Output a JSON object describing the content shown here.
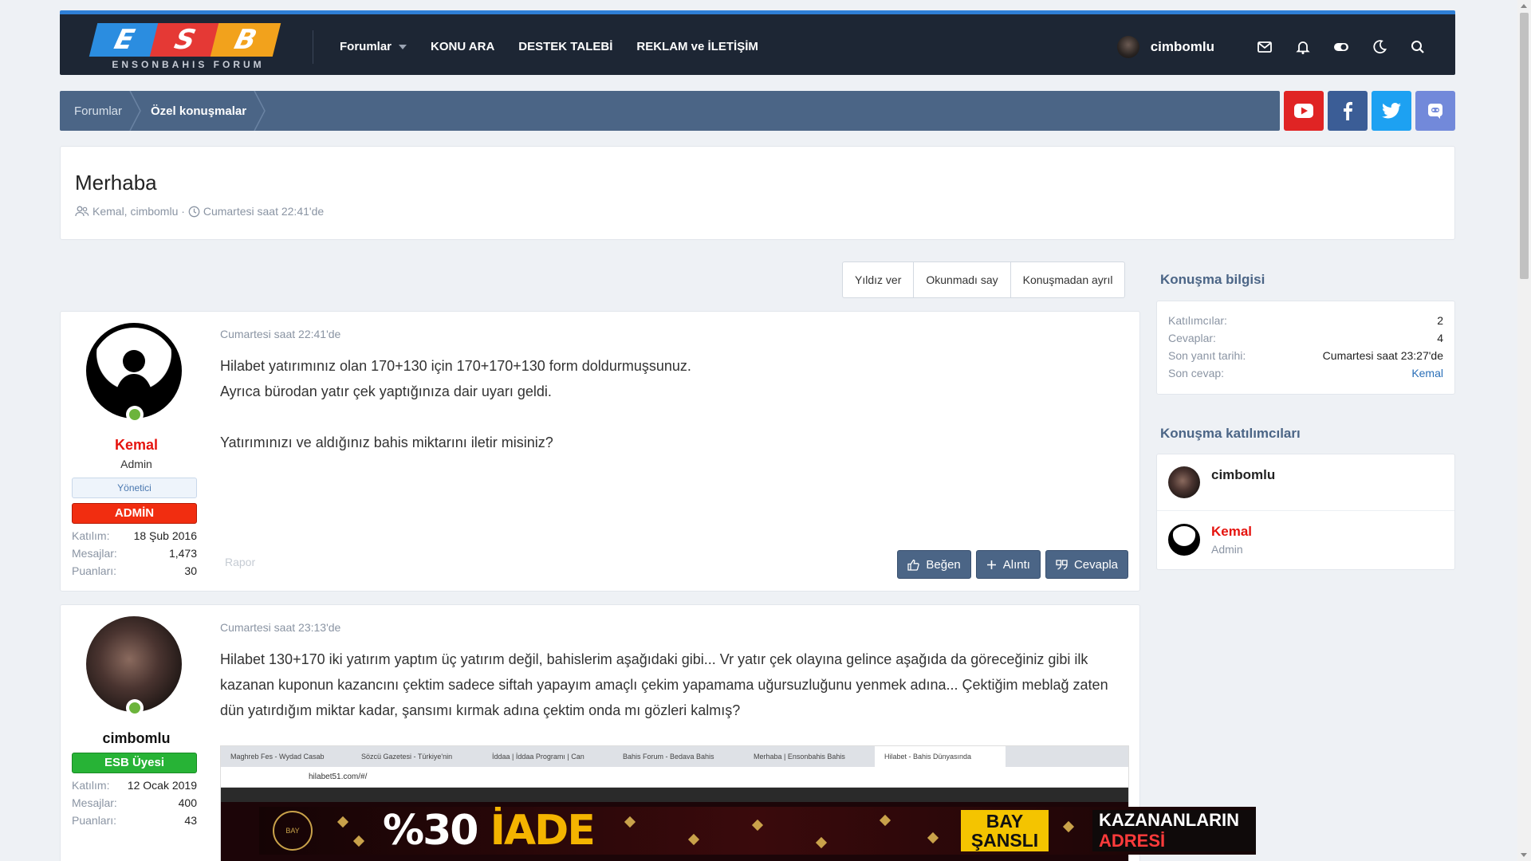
{
  "logo": {
    "letters": [
      "E",
      "S",
      "B"
    ],
    "subtitle": "ENSONBAHIS FORUM"
  },
  "nav": {
    "items": [
      "Forumlar",
      "KONU ARA",
      "DESTEK TALEBİ",
      "REKLAM ve İLETİŞİM"
    ]
  },
  "header": {
    "username": "cimbomlu",
    "icons": [
      "mail-icon",
      "bell-icon",
      "toggle-icon",
      "moon-icon",
      "search-icon"
    ]
  },
  "breadcrumb": {
    "items": [
      "Forumlar",
      "Özel konuşmalar"
    ]
  },
  "social": [
    "youtube-icon",
    "facebook-icon",
    "twitter-icon",
    "discord-icon"
  ],
  "colors": {
    "header_bg": "#1d2634",
    "accent": "#4b6586",
    "admin_red": "#f12d10",
    "esb_green": "#27b336",
    "username_red": "#e5140f"
  },
  "conversation": {
    "title": "Merhaba",
    "participants": "Kemal, cimbomlu",
    "date": "Cumartesi saat 22:41'de"
  },
  "buttons": {
    "star": "Yıldız ver",
    "unread": "Okunmadı say",
    "leave": "Konuşmadan ayrıl"
  },
  "messages": [
    {
      "username": "Kemal",
      "user_title": "Admin",
      "badge_group": "Yönetici",
      "badge_role": "ADMİN",
      "stats": [
        {
          "label": "Katılım:",
          "value": "18 Şub 2016"
        },
        {
          "label": "Mesajlar:",
          "value": "1,473"
        },
        {
          "label": "Puanları:",
          "value": "30"
        }
      ],
      "date": "Cumartesi saat 22:41'de",
      "lines": [
        "Hilabet yatırımınız olan 170+130 için 170+170+130 form doldurmuşsunuz.",
        "Ayrıca bürodan yatır çek yaptığınıza dair uyarı geldi.",
        "Yatırımınızı ve aldığınız bahis miktarını iletir misiniz?"
      ],
      "report": "Rapor",
      "actions": [
        "Beğen",
        "Alıntı",
        "Cevapla"
      ]
    },
    {
      "username": "cimbomlu",
      "badge_role": "ESB Üyesi",
      "stats": [
        {
          "label": "Katılım:",
          "value": "12 Ocak 2019"
        },
        {
          "label": "Mesajlar:",
          "value": "400"
        },
        {
          "label": "Puanları:",
          "value": "43"
        }
      ],
      "date": "Cumartesi saat 23:13'de",
      "lines": [
        "Hilabet 130+170 iki yatırım yaptım üç yatırım değil, bahislerim aşağıdaki gibi... Vr yatır çek olayına gelince aşağıda da göreceğiniz gibi ilk",
        "kazanan kuponun kazancını çektim sadece siftah yapayım amaçlı çekim yapamama uğursuzluğunu yenmek adına... Çektiğim meblağ zaten",
        "dün yatırdığım miktar kadar, şansımı kırmak adına çektim onda mı gözleri kalmış?"
      ],
      "embed": {
        "tabs": [
          "Maghreb Fes - Wydad Casab",
          "Sözcü Gazetesi - Türkiye'nin",
          "İddaa | İddaa Programı | Can",
          "Bahis Forum - Bedava Bahis",
          "Merhaba | Ensonbahis Bahis",
          "Hilabet - Bahis Dünyasında"
        ],
        "url": "hilabet51.com/#/"
      }
    }
  ],
  "banner": {
    "logo": "BAY ŞANSLI",
    "percent": "%30",
    "word": "İADE",
    "brand_top": "BAY",
    "brand_bottom": "ŞANSLI",
    "right_top": "KAZANANLARIN",
    "right_bottom": "ADRESİ"
  },
  "sidebar": {
    "info_title": "Konuşma bilgisi",
    "info": [
      {
        "label": "Katılımcılar:",
        "value": "2"
      },
      {
        "label": "Cevaplar:",
        "value": "4"
      },
      {
        "label": "Son yanıt tarihi:",
        "value": "Cumartesi saat 23:27'de"
      },
      {
        "label": "Son cevap:",
        "value": "Kemal"
      }
    ],
    "participants_title": "Konuşma katılımcıları",
    "participants": [
      {
        "name": "cimbomlu",
        "sub": ""
      },
      {
        "name": "Kemal",
        "sub": "Admin"
      }
    ]
  }
}
